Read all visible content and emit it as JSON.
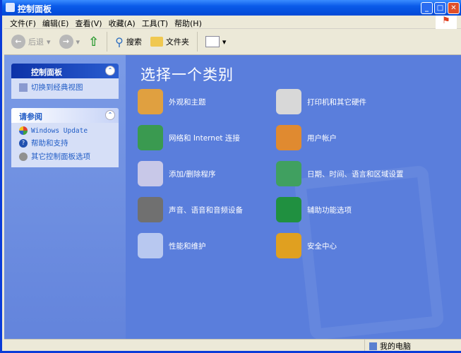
{
  "window": {
    "title": "控制面板"
  },
  "menu": [
    "文件(F)",
    "编辑(E)",
    "查看(V)",
    "收藏(A)",
    "工具(T)",
    "帮助(H)"
  ],
  "toolbar": {
    "back": "后退",
    "search": "搜索",
    "folders": "文件夹"
  },
  "sidebar": {
    "panel": {
      "title": "控制面板",
      "items": [
        "切换到经典视图"
      ]
    },
    "see_also": {
      "title": "请参阅",
      "items": [
        "Windows Update",
        "帮助和支持",
        "其它控制面板选项"
      ]
    }
  },
  "main": {
    "heading": "选择一个类别",
    "categories": [
      {
        "label": "外观和主题",
        "color": "#e0a040"
      },
      {
        "label": "打印机和其它硬件",
        "color": "#d8d8d8"
      },
      {
        "label": "网络和 Internet 连接",
        "color": "#3a9a50"
      },
      {
        "label": "用户帐户",
        "color": "#e08a30"
      },
      {
        "label": "添加/删除程序",
        "color": "#c8c8e8"
      },
      {
        "label": "日期、时间、语言和区域设置",
        "color": "#40a060"
      },
      {
        "label": "声音、语音和音频设备",
        "color": "#707070"
      },
      {
        "label": "辅助功能选项",
        "color": "#209040"
      },
      {
        "label": "性能和维护",
        "color": "#b8c8f0"
      },
      {
        "label": "安全中心",
        "color": "#e0a020"
      }
    ]
  },
  "status": {
    "location": "我的电脑"
  }
}
